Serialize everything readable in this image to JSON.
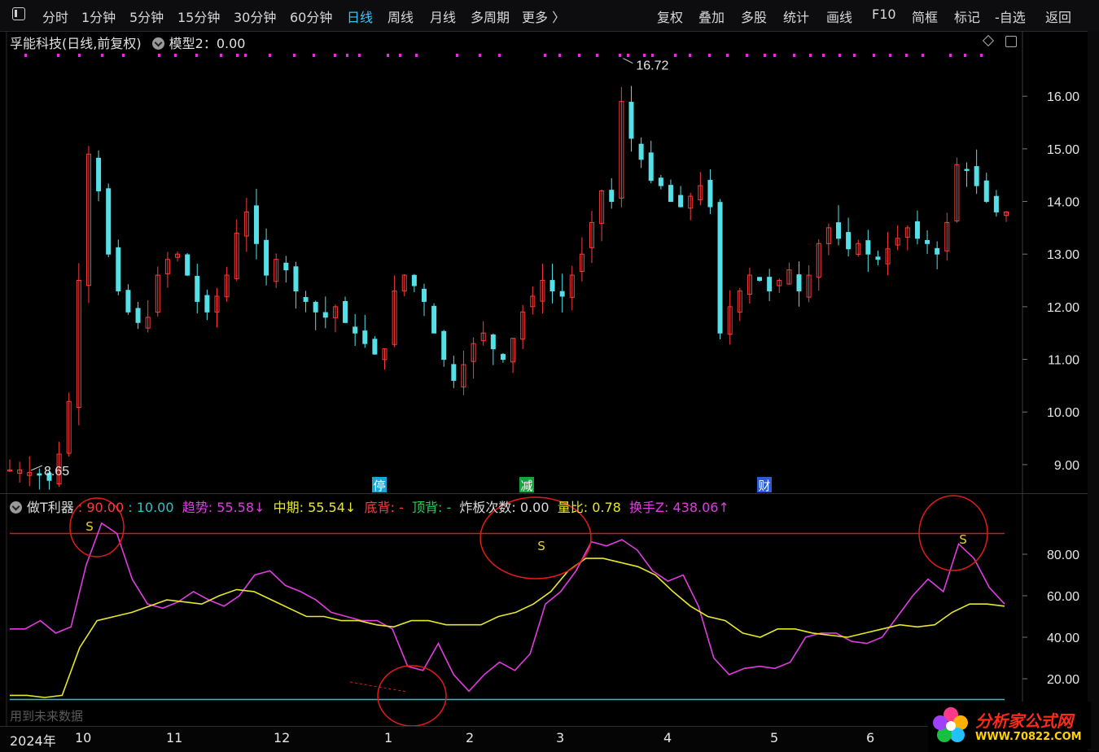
{
  "toolbar": {
    "left_items": [
      "分时",
      "1分钟",
      "5分钟",
      "15分钟",
      "30分钟",
      "60分钟",
      "日线",
      "周线",
      "月线",
      "多周期",
      "更多 〉"
    ],
    "active": "日线",
    "right_items": [
      "复权",
      "叠加",
      "多股",
      "统计",
      "画线",
      "F10",
      "简框",
      "标记",
      "-自选",
      "返回"
    ]
  },
  "title": {
    "name": "孚能科技(日线,前复权)",
    "model": "模型2：0.00"
  },
  "price_annotations": {
    "high": "16.72",
    "low": "8.65"
  },
  "event_tags": [
    {
      "label": "停",
      "color": "#1aa7d6"
    },
    {
      "label": "减",
      "color": "#18a23a"
    },
    {
      "label": "财",
      "color": "#2a5bd8"
    }
  ],
  "indicator": {
    "name": "做T利器",
    "p1": ": 90.00",
    "p2": ": 10.00",
    "trend_label": "趋势",
    "trend_value": ": 55.58↓",
    "mid_label": "中期",
    "mid_value": ": 55.54↓",
    "bottom_label": "底背",
    "bottom_value": ": -",
    "top_label": "顶背",
    "top_value": ": -",
    "burst_label": "炸板次数",
    "burst_value": ": 0.00",
    "vol_label": "量比",
    "vol_value": ": 0.78",
    "turn_label": "换手Z",
    "turn_value": ": 438.06↑",
    "signal_letter": "S"
  },
  "watermark": "用到未来数据",
  "x_axis_labels": [
    "2024年",
    "10",
    "11",
    "12",
    "1",
    "2",
    "3",
    "4",
    "5",
    "6"
  ],
  "logo": {
    "text": "分析家公式网",
    "url": "WWW.70822.COM"
  },
  "colors": {
    "up": "#ff3b3b",
    "down": "#54e0e6",
    "trend": "#e03ce0",
    "mid": "#e8e82a",
    "ref_line_high": "#d01c1c",
    "ref_line_low": "#29c6c6"
  },
  "chart_data": [
    {
      "type": "candlestick",
      "y_ticks": [
        9.0,
        10.0,
        11.0,
        12.0,
        13.0,
        14.0,
        15.0,
        16.0
      ],
      "ylim": [
        8.55,
        16.9
      ],
      "x_periods": [
        "2024-09",
        "2024-10",
        "2024-11",
        "2024-12",
        "2025-01",
        "2025-02",
        "2025-03",
        "2025-04",
        "2025-05",
        "2025-06"
      ],
      "high": 16.72,
      "low": 8.65,
      "close_trend": [
        8.9,
        8.9,
        8.85,
        8.8,
        8.7,
        9.2,
        10.2,
        12.5,
        14.9,
        14.2,
        13.0,
        12.3,
        11.9,
        11.7,
        11.8,
        12.6,
        12.9,
        13.0,
        12.6,
        12.1,
        11.9,
        12.2,
        12.6,
        13.4,
        13.8,
        13.2,
        12.6,
        12.9,
        12.7,
        12.3,
        12.1,
        11.9,
        11.8,
        12.0,
        11.7,
        11.5,
        11.3,
        11.1,
        11.2,
        12.3,
        12.6,
        12.4,
        12.1,
        11.5,
        11.0,
        10.6,
        10.9,
        11.3,
        11.5,
        11.2,
        11.0,
        11.4,
        11.9,
        12.2,
        12.5,
        12.3,
        12.2,
        12.6,
        13.0,
        13.6,
        14.2,
        14.0,
        15.9,
        15.2,
        14.8,
        14.4,
        14.3,
        14.0,
        13.9,
        14.1,
        14.3,
        13.9,
        11.5,
        12.0,
        12.3,
        12.6,
        12.5,
        12.3,
        12.5,
        12.7,
        12.3,
        12.6,
        13.2,
        13.5,
        13.3,
        13.1,
        13.2,
        13.0,
        12.9,
        13.1,
        13.3,
        13.5,
        13.3,
        13.2,
        13.0,
        13.6,
        14.7,
        14.6,
        14.3,
        14.0,
        13.8,
        13.8
      ]
    },
    {
      "type": "line",
      "y_ticks": [
        20.0,
        40.0,
        60.0,
        80.0
      ],
      "ylim": [
        0,
        100
      ],
      "reference_lines": [
        90,
        10
      ],
      "series": [
        {
          "name": "趋势",
          "values": [
            44,
            44,
            48,
            42,
            45,
            75,
            95,
            90,
            68,
            56,
            54,
            57,
            62,
            58,
            55,
            60,
            70,
            72,
            65,
            62,
            58,
            52,
            50,
            48,
            48,
            44,
            26,
            24,
            37,
            22,
            14,
            22,
            28,
            24,
            32,
            56,
            62,
            72,
            86,
            84,
            87,
            82,
            72,
            67,
            70,
            55,
            30,
            22,
            25,
            26,
            25,
            28,
            40,
            42,
            42,
            38,
            37,
            40,
            50,
            60,
            68,
            62,
            85,
            78,
            64,
            56
          ]
        },
        {
          "name": "中期",
          "values": [
            12,
            12,
            11,
            12,
            35,
            48,
            50,
            52,
            55,
            58,
            57,
            56,
            60,
            63,
            62,
            58,
            54,
            50,
            50,
            48,
            48,
            46,
            45,
            48,
            48,
            46,
            46,
            46,
            50,
            52,
            56,
            62,
            72,
            78,
            78,
            76,
            74,
            70,
            62,
            55,
            50,
            48,
            42,
            40,
            44,
            44,
            42,
            41,
            40,
            42,
            44,
            46,
            45,
            46,
            52,
            56,
            56,
            55
          ]
        }
      ]
    }
  ]
}
